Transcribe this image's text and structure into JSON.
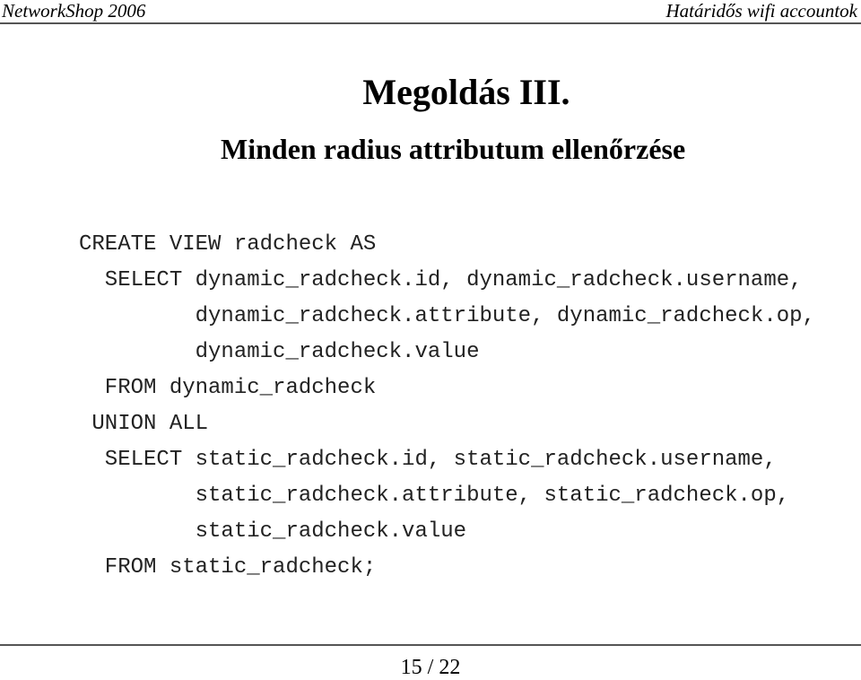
{
  "header": {
    "left": "NetworkShop 2006",
    "right": "Határidős wifi accountok"
  },
  "slide": {
    "title": "Megoldás III.",
    "subtitle": "Minden radius attributum ellenőrzése",
    "code_lines": [
      "CREATE VIEW radcheck AS",
      "  SELECT dynamic_radcheck.id, dynamic_radcheck.username,",
      "         dynamic_radcheck.attribute, dynamic_radcheck.op,",
      "         dynamic_radcheck.value",
      "  FROM dynamic_radcheck",
      " UNION ALL",
      "  SELECT static_radcheck.id, static_radcheck.username,",
      "         static_radcheck.attribute, static_radcheck.op,",
      "         static_radcheck.value",
      "  FROM static_radcheck;"
    ]
  },
  "footer": {
    "page": "15 / 22"
  }
}
